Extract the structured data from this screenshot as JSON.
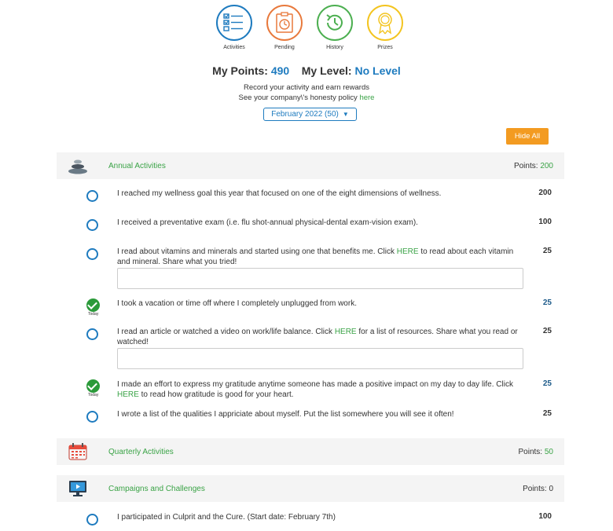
{
  "nav": [
    {
      "label": "Activities",
      "color": "#1e7bbf",
      "icon": "checklist-icon"
    },
    {
      "label": "Pending",
      "color": "#e8793c",
      "icon": "stopwatch-icon"
    },
    {
      "label": "History",
      "color": "#4caf50",
      "icon": "history-icon"
    },
    {
      "label": "Prizes",
      "color": "#f3c41f",
      "icon": "award-ribbon-icon"
    }
  ],
  "summary": {
    "points_label": "My Points:",
    "points_value": "490",
    "level_label": "My Level:",
    "level_value": "No Level",
    "line1": "Record your activity and earn rewards",
    "line2_prefix": "See your company\\'s honesty policy",
    "line2_link": "here"
  },
  "month_select": {
    "value": "February 2022 (50)"
  },
  "hide_button": {
    "label": "Hide All"
  },
  "sections": [
    {
      "title": "Annual Activities",
      "points_label": "Points:",
      "points_value": "200",
      "icon": "stones-icon"
    },
    {
      "title": "Quarterly Activities",
      "points_label": "Points:",
      "points_value": "50",
      "icon": "calendar-icon"
    },
    {
      "title": "Campaigns and Challenges",
      "points_label": "Points:",
      "points_value": "0",
      "icon": "monitor-icon"
    }
  ],
  "activities": [
    {
      "text": "I reached my wellness goal this year that focused on one of the eight dimensions of wellness.",
      "points": "200",
      "completed": false
    },
    {
      "text": "I received a preventative exam (i.e. flu shot-annual physical-dental exam-vision exam).",
      "points": "100",
      "completed": false
    },
    {
      "text_pre": "I read about vitamins and minerals and started using one that benefits me. Click ",
      "link": "HERE",
      "text_post": " to read about each vitamin and mineral. Share what you tried!",
      "points": "25",
      "completed": false
    },
    {
      "text": "I took a vacation or time off where I completely unplugged from work.",
      "points": "25",
      "completed": true,
      "badge": "Today"
    },
    {
      "text_pre": "I read an article or watched a video on work/life balance.  Click ",
      "link": "HERE",
      "text_post": " for a list of resources. Share what you read or watched!",
      "points": "25",
      "completed": false
    },
    {
      "text_pre": "I made an effort to express my gratitude anytime someone has made a positive impact on my day to day life. Click ",
      "link": "HERE",
      "text_post": " to read how gratitude is good for your heart.",
      "points": "25",
      "completed": true,
      "badge": "Today"
    },
    {
      "text": "I wrote a list of the qualities I appriciate about myself.  Put the list somewhere you will see it often!",
      "points": "25",
      "completed": false
    },
    {
      "text": "I participated in Culprit and the Cure. (Start date: February 7th)",
      "points": "100",
      "completed": false
    }
  ]
}
